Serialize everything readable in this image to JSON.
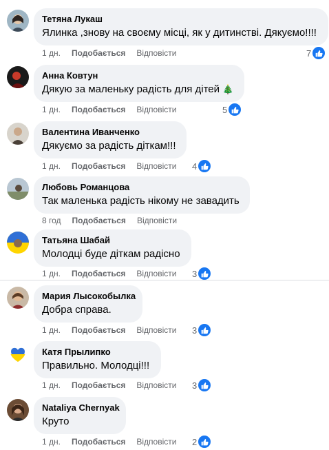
{
  "comments": [
    {
      "author": "Тетяна Лукаш",
      "text": "Ялинка ,знову на своєму місці, як у дитинстві. Дякуємо!!!!",
      "time": "1 дн.",
      "like": "Подобається",
      "reply": "Відповісти",
      "likes": "7"
    },
    {
      "author": "Анна Ковтун",
      "text": "Дякую за маленьку радість для дітей",
      "emoji": "🎄",
      "time": "1 дн.",
      "like": "Подобається",
      "reply": "Відповісти",
      "likes": "5"
    },
    {
      "author": "Валентина Иванченко",
      "text": "Дякуємо за радість діткам!!!",
      "time": "1 дн.",
      "like": "Подобається",
      "reply": "Відповісти",
      "likes": "4"
    },
    {
      "author": "Любовь Романцова",
      "text": "Так маленька радість нікому не завадить",
      "time": "8 год",
      "like": "Подобається",
      "reply": "Відповісти",
      "likes": ""
    },
    {
      "author": "Татьяна Шабай",
      "text": "Молодці буде діткам радісно",
      "time": "1 дн.",
      "like": "Подобається",
      "reply": "Відповісти",
      "likes": "3"
    },
    {
      "author": "Мария Лысокобылка",
      "text": "Добра справа.",
      "time": "1 дн.",
      "like": "Подобається",
      "reply": "Відповісти",
      "likes": "3"
    },
    {
      "author": "Катя Прылипко",
      "text": "Правильно. Молодці!!!",
      "time": "1 дн.",
      "like": "Подобається",
      "reply": "Відповісти",
      "likes": "3"
    },
    {
      "author": "Nataliya Chernyak",
      "text": "Круто",
      "time": "1 дн.",
      "like": "Подобається",
      "reply": "Відповісти",
      "likes": "2"
    }
  ],
  "colors": {
    "bubble": "#f0f2f5",
    "meta": "#65676b",
    "like_blue": "#1877f2"
  },
  "icons": {
    "reaction": "thumbs-up-icon",
    "emoji": "christmas-tree-icon"
  }
}
